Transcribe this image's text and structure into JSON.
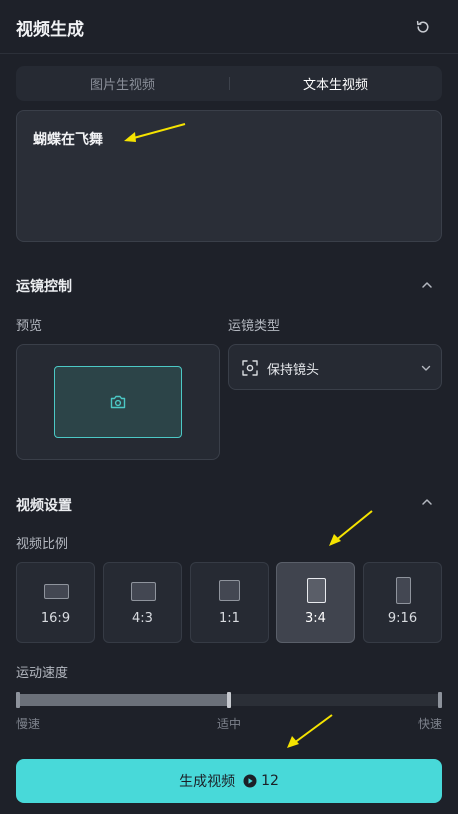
{
  "header": {
    "title": "视频生成",
    "reset_icon": "refresh-icon"
  },
  "tabs": [
    {
      "label": "图片生视频",
      "active": false
    },
    {
      "label": "文本生视频",
      "active": true
    }
  ],
  "prompt": {
    "value": "蝴蝶在飞舞"
  },
  "camera_control": {
    "title": "运镜控制",
    "preview_label": "预览",
    "type_label": "运镜类型",
    "selected_type": "保持镜头"
  },
  "video_settings": {
    "title": "视频设置",
    "ratio_label": "视频比例",
    "ratios": [
      {
        "label": "16:9",
        "selected": false
      },
      {
        "label": "4:3",
        "selected": false
      },
      {
        "label": "1:1",
        "selected": false
      },
      {
        "label": "3:4",
        "selected": true
      },
      {
        "label": "9:16",
        "selected": false
      }
    ],
    "speed_label": "运动速度",
    "speed": {
      "slow": "慢速",
      "medium": "适中",
      "fast": "快速",
      "value_fraction": 0.5
    }
  },
  "generate": {
    "label": "生成视频",
    "cost": "12"
  },
  "colors": {
    "accent": "#48d9d9",
    "annotation": "#f5e300",
    "background": "#1e2129"
  }
}
